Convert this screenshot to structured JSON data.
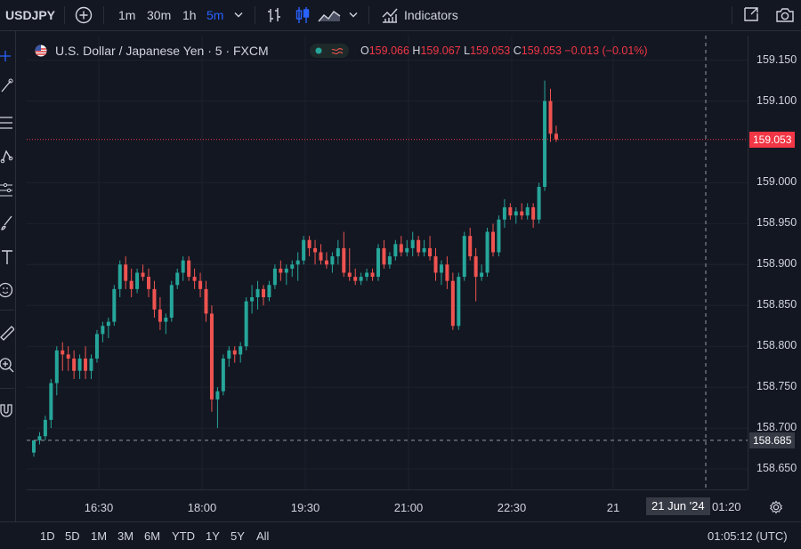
{
  "header": {
    "symbol": "USDJPY",
    "intervals": [
      "1m",
      "30m",
      "1h",
      "5m"
    ],
    "active_interval": "5m",
    "indicators_label": "Indicators"
  },
  "legend": {
    "title": "U.S. Dollar / Japanese Yen · 5 · FXCM",
    "o_label": "O",
    "o": "159.066",
    "h_label": "H",
    "h": "159.067",
    "l_label": "L",
    "l": "159.053",
    "c_label": "C",
    "c": "159.053",
    "change": "−0.013 (−0.01%)"
  },
  "price_axis": {
    "ticks": [
      "159.150",
      "159.100",
      "159.000",
      "158.950",
      "158.900",
      "158.850",
      "158.800",
      "158.750",
      "158.700",
      "158.650"
    ],
    "last_price_label": "159.053",
    "crosshair_price_label": "158.685"
  },
  "time_axis": {
    "ticks": [
      "16:30",
      "18:00",
      "19:30",
      "21:00",
      "22:30",
      "21"
    ],
    "crosshair_time_label": "21 Jun '24",
    "extra_tick": "01:20"
  },
  "bottom": {
    "ranges": [
      "1D",
      "5D",
      "1M",
      "3M",
      "6M",
      "YTD",
      "1Y",
      "5Y",
      "All"
    ],
    "clock": "01:05:12 (UTC)"
  },
  "colors": {
    "up": "#26a69a",
    "down": "#ef5350",
    "accent": "#2962ff",
    "bg": "#131722"
  },
  "chart_data": {
    "type": "candlestick",
    "ylim": [
      158.625,
      159.18
    ],
    "last_price": 159.053,
    "crosshair_price": 158.685,
    "candles": [
      [
        158.67,
        158.685,
        158.665,
        158.685
      ],
      [
        158.685,
        158.695,
        158.68,
        158.69
      ],
      [
        158.69,
        158.715,
        158.685,
        158.71
      ],
      [
        158.71,
        158.76,
        158.7,
        158.755
      ],
      [
        158.755,
        158.8,
        158.74,
        158.795
      ],
      [
        158.795,
        158.805,
        158.77,
        158.79
      ],
      [
        158.79,
        158.8,
        158.77,
        158.785
      ],
      [
        158.785,
        158.795,
        158.76,
        158.77
      ],
      [
        158.77,
        158.79,
        158.76,
        158.785
      ],
      [
        158.785,
        158.8,
        158.76,
        158.77
      ],
      [
        158.77,
        158.79,
        158.76,
        158.785
      ],
      [
        158.785,
        158.82,
        158.78,
        158.815
      ],
      [
        158.815,
        158.83,
        158.805,
        158.825
      ],
      [
        158.825,
        158.835,
        158.81,
        158.83
      ],
      [
        158.83,
        158.875,
        158.825,
        158.87
      ],
      [
        158.87,
        158.905,
        158.86,
        158.9
      ],
      [
        158.9,
        158.91,
        158.87,
        158.88
      ],
      [
        158.88,
        158.895,
        158.86,
        158.87
      ],
      [
        158.87,
        158.895,
        158.865,
        158.89
      ],
      [
        158.89,
        158.9,
        158.88,
        158.885
      ],
      [
        158.885,
        158.895,
        158.86,
        158.87
      ],
      [
        158.87,
        158.88,
        158.835,
        158.845
      ],
      [
        158.845,
        158.86,
        158.82,
        158.83
      ],
      [
        158.83,
        158.84,
        158.815,
        158.835
      ],
      [
        158.835,
        158.88,
        158.83,
        158.875
      ],
      [
        158.875,
        158.895,
        158.87,
        158.89
      ],
      [
        158.89,
        158.91,
        158.88,
        158.905
      ],
      [
        158.905,
        158.91,
        158.88,
        158.885
      ],
      [
        158.885,
        158.895,
        158.87,
        158.88
      ],
      [
        158.88,
        158.89,
        158.86,
        158.87
      ],
      [
        158.87,
        158.88,
        158.83,
        158.84
      ],
      [
        158.84,
        158.85,
        158.72,
        158.735
      ],
      [
        158.735,
        158.75,
        158.7,
        158.745
      ],
      [
        158.745,
        158.79,
        158.74,
        158.785
      ],
      [
        158.785,
        158.8,
        158.775,
        158.795
      ],
      [
        158.795,
        158.8,
        158.78,
        158.79
      ],
      [
        158.79,
        158.805,
        158.78,
        158.8
      ],
      [
        158.8,
        158.86,
        158.795,
        158.855
      ],
      [
        158.855,
        158.875,
        158.84,
        158.86
      ],
      [
        158.86,
        158.88,
        158.845,
        158.87
      ],
      [
        158.87,
        158.875,
        158.85,
        158.86
      ],
      [
        158.86,
        158.88,
        158.855,
        158.875
      ],
      [
        158.875,
        158.9,
        158.87,
        158.895
      ],
      [
        158.895,
        158.905,
        158.88,
        158.89
      ],
      [
        158.89,
        158.9,
        158.875,
        158.895
      ],
      [
        158.895,
        158.905,
        158.885,
        158.9
      ],
      [
        158.9,
        158.915,
        158.88,
        158.905
      ],
      [
        158.905,
        158.935,
        158.9,
        158.93
      ],
      [
        158.93,
        158.935,
        158.91,
        158.92
      ],
      [
        158.92,
        158.93,
        158.9,
        158.915
      ],
      [
        158.915,
        158.925,
        158.9,
        158.905
      ],
      [
        158.905,
        158.915,
        158.895,
        158.9
      ],
      [
        158.9,
        158.915,
        158.89,
        158.91
      ],
      [
        158.91,
        158.93,
        158.9,
        158.92
      ],
      [
        158.92,
        158.94,
        158.885,
        158.89
      ],
      [
        158.89,
        158.92,
        158.88,
        158.885
      ],
      [
        158.885,
        158.895,
        158.875,
        158.88
      ],
      [
        158.88,
        158.89,
        158.875,
        158.885
      ],
      [
        158.885,
        158.895,
        158.88,
        158.89
      ],
      [
        158.89,
        158.895,
        158.88,
        158.885
      ],
      [
        158.885,
        158.925,
        158.88,
        158.92
      ],
      [
        158.92,
        158.93,
        158.895,
        158.9
      ],
      [
        158.9,
        158.915,
        158.895,
        158.91
      ],
      [
        158.91,
        158.93,
        158.905,
        158.925
      ],
      [
        158.925,
        158.935,
        158.91,
        158.915
      ],
      [
        158.915,
        158.93,
        158.91,
        158.92
      ],
      [
        158.92,
        158.94,
        158.91,
        158.93
      ],
      [
        158.93,
        158.935,
        158.91,
        158.915
      ],
      [
        158.915,
        158.93,
        158.91,
        158.92
      ],
      [
        158.92,
        158.935,
        158.905,
        158.91
      ],
      [
        158.91,
        158.92,
        158.88,
        158.89
      ],
      [
        158.89,
        158.905,
        158.875,
        158.9
      ],
      [
        158.9,
        158.91,
        158.87,
        158.88
      ],
      [
        158.88,
        158.89,
        158.82,
        158.825
      ],
      [
        158.825,
        158.89,
        158.82,
        158.885
      ],
      [
        158.885,
        158.94,
        158.88,
        158.935
      ],
      [
        158.935,
        158.945,
        158.905,
        158.91
      ],
      [
        158.91,
        158.92,
        158.855,
        158.885
      ],
      [
        158.885,
        158.9,
        158.88,
        158.89
      ],
      [
        158.89,
        158.945,
        158.885,
        158.94
      ],
      [
        158.94,
        158.95,
        158.91,
        158.915
      ],
      [
        158.915,
        158.96,
        158.91,
        158.955
      ],
      [
        158.955,
        158.98,
        158.945,
        158.97
      ],
      [
        158.97,
        158.975,
        158.955,
        158.96
      ],
      [
        158.96,
        158.97,
        158.95,
        158.965
      ],
      [
        158.965,
        158.975,
        158.955,
        158.96
      ],
      [
        158.96,
        158.975,
        158.955,
        158.97
      ],
      [
        158.97,
        158.975,
        158.945,
        158.955
      ],
      [
        158.955,
        159.0,
        158.95,
        158.995
      ],
      [
        158.995,
        159.125,
        158.99,
        159.1
      ],
      [
        159.1,
        159.115,
        159.05,
        159.06
      ],
      [
        159.06,
        159.07,
        159.05,
        159.053
      ]
    ]
  }
}
